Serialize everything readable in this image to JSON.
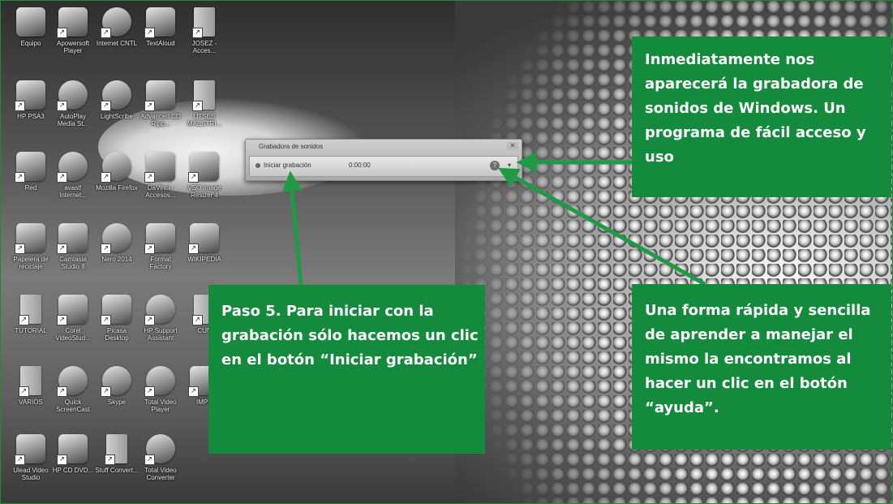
{
  "desktop_icons": [
    {
      "label": "Equipo",
      "icon": "computer-icon"
    },
    {
      "label": "Apowersoft Player",
      "icon": "media-player-icon"
    },
    {
      "label": "Internet CNTL",
      "icon": "globe-icon"
    },
    {
      "label": "TextAloud",
      "icon": "textaloud-icon"
    },
    {
      "label": "JOSEZ - Acces...",
      "icon": "folder-icon"
    },
    {
      "label": "HP PSA3",
      "icon": "printer-icon"
    },
    {
      "label": "AutoPlay Media St...",
      "icon": "disc-icon"
    },
    {
      "label": "LightScribe",
      "icon": "disc-icon"
    },
    {
      "label": "Advanced CD Ripp...",
      "icon": "cd-ripper-icon"
    },
    {
      "label": "UTSES MAESTRI...",
      "icon": "folder-icon"
    },
    {
      "label": "Red",
      "icon": "network-icon"
    },
    {
      "label": "avast! Internet...",
      "icon": "avast-icon"
    },
    {
      "label": "Mozilla Firefox",
      "icon": "firefox-icon"
    },
    {
      "label": "DaVinci - Accesos...",
      "icon": "picture-icon"
    },
    {
      "label": "VSO Image Resizer 4",
      "icon": "image-resizer-icon"
    },
    {
      "label": "Papelera de reciclaje",
      "icon": "recycle-bin-icon"
    },
    {
      "label": "Camtasia Studio 8",
      "icon": "camtasia-icon"
    },
    {
      "label": "Nero 2014",
      "icon": "nero-icon"
    },
    {
      "label": "Format Factory",
      "icon": "format-factory-icon"
    },
    {
      "label": "WIKIPEDIA",
      "icon": "wikipedia-icon"
    },
    {
      "label": "TUTORIAL",
      "icon": "folder-icon"
    },
    {
      "label": "Corel VideoStud...",
      "icon": "video-icon"
    },
    {
      "label": "Picasa Desktop",
      "icon": "picasa-icon"
    },
    {
      "label": "HP Support Assistant",
      "icon": "help-icon"
    },
    {
      "label": "CUN",
      "icon": "word-icon"
    },
    {
      "label": "VARIOS",
      "icon": "folder-icon"
    },
    {
      "label": "Quick ScreenCast",
      "icon": "webcam-icon"
    },
    {
      "label": "Skype",
      "icon": "skype-icon"
    },
    {
      "label": "Total Video Player",
      "icon": "play-icon"
    },
    {
      "label": "IMPU",
      "icon": "keyboard-icon"
    },
    {
      "label": "Ulead Video Studio",
      "icon": "film-icon"
    },
    {
      "label": "HP CD DVD...",
      "icon": "window-icon"
    },
    {
      "label": "Stuff Convert...",
      "icon": "document-icon"
    },
    {
      "label": "Total Video Converter",
      "icon": "converter-icon"
    }
  ],
  "recorder": {
    "title": "Grabadora de sonidos",
    "start_label": "Iniciar grabación",
    "time": "0:00:00",
    "help_glyph": "?",
    "dropdown_glyph": "▾",
    "close_glyph": "✕"
  },
  "callouts": {
    "top": "Inmediatamente nos aparecerá la grabadora de sonidos de Windows. Un programa de fácil acceso y uso",
    "left": "Paso 5. Para iniciar con la grabación sólo hacemos un clic en el botón “Iniciar grabación”",
    "right": "Una forma rápida y sencilla de aprender a manejar el mismo la encontramos al hacer un clic en el botón “ayuda”."
  },
  "colors": {
    "callout_green": "#148a3c",
    "arrow_green": "#1f9a45"
  }
}
